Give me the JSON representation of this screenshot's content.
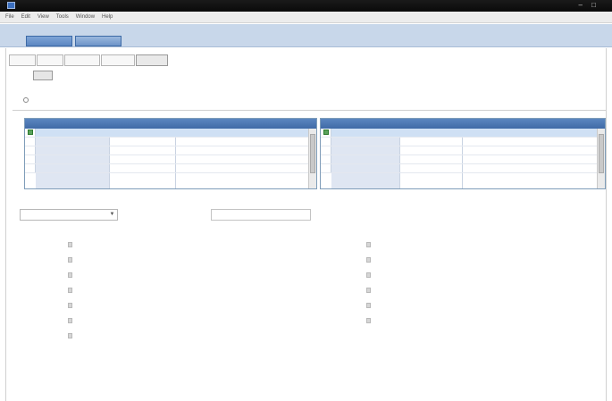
{
  "window": {
    "title": "",
    "controls": "‒ □"
  },
  "menubar": {
    "items": [
      "File",
      "Edit",
      "View",
      "Tools",
      "Window",
      "Help"
    ]
  },
  "doc_tabs": [
    {
      "label": ""
    },
    {
      "label": ""
    }
  ],
  "subtabs": [
    {
      "label": ""
    },
    {
      "label": ""
    },
    {
      "label": ""
    },
    {
      "label": ""
    },
    {
      "label": ""
    }
  ],
  "filter": {
    "label": "",
    "button_label": ""
  },
  "section_label": "",
  "options": {
    "radio_label": "",
    "option_a": "",
    "option_b": ""
  },
  "left_grid": {
    "columns": [
      "",
      ""
    ],
    "rows": [
      {
        "key": "",
        "value": ""
      },
      {
        "key": "",
        "value": ""
      },
      {
        "key": "",
        "value": ""
      },
      {
        "key": "",
        "value": ""
      },
      {
        "key": "",
        "value": ""
      }
    ]
  },
  "right_grid": {
    "columns": [
      "",
      "",
      ""
    ],
    "rows": [
      {
        "key": "",
        "value": ""
      },
      {
        "key": "",
        "value": ""
      },
      {
        "key": "",
        "value": ""
      },
      {
        "key": "",
        "value": ""
      },
      {
        "key": "",
        "value": ""
      }
    ]
  },
  "bottom_bar": {
    "combo_value": "",
    "label": "",
    "input_value": "",
    "right_text": "",
    "right_link": ""
  },
  "results_label": "",
  "results_left": [
    {
      "text": ""
    },
    {
      "text": ""
    },
    {
      "text": ""
    },
    {
      "text": ""
    },
    {
      "text": ""
    },
    {
      "text": ""
    },
    {
      "text": ""
    }
  ],
  "results_right": [
    {
      "text": ""
    },
    {
      "text": ""
    },
    {
      "text": ""
    },
    {
      "text": ""
    },
    {
      "text": ""
    },
    {
      "text": ""
    }
  ]
}
